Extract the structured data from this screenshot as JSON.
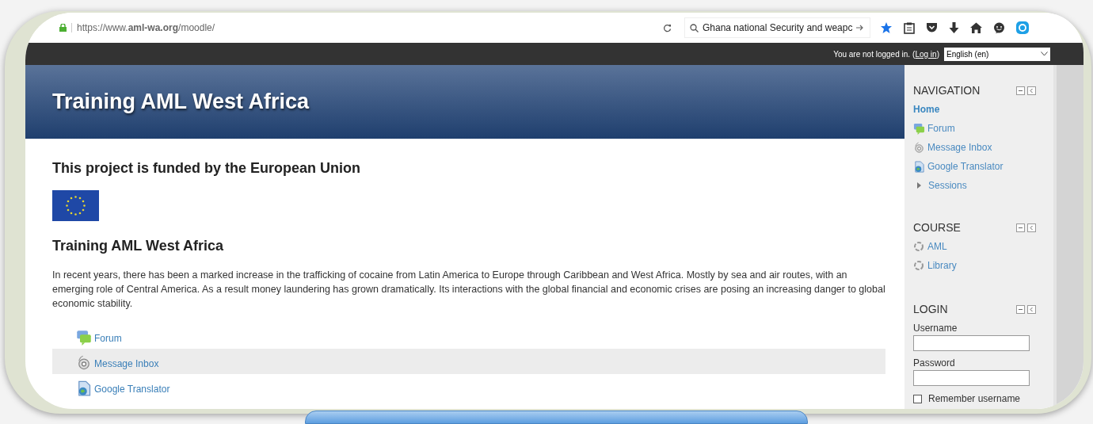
{
  "browser": {
    "url": "https://www.**aml-wa.org**/moodle/",
    "search_value": "Ghana national Security and weapc"
  },
  "top_bar": {
    "status": "You are not logged in.",
    "bracket_open": "(",
    "login_link": "Log in",
    "bracket_close": ")",
    "language": "English (en)"
  },
  "header": {
    "title": "Training AML West Africa"
  },
  "content": {
    "funding_heading": "This project is funded by the European Union",
    "heading": "Training AML West Africa",
    "paragraph": "In recent years, there has been a marked increase in the trafficking of cocaine from Latin America to Europe through Caribbean and West Africa. Mostly by sea and air routes, with an emerging role of Central America. As a result money laundering has grown dramatically. Its interactions with the global financial and economic crises are posing an increasing danger to global economic stability.",
    "links": [
      {
        "label": "Forum",
        "kind": "forum",
        "highlighted": false
      },
      {
        "label": "Message Inbox",
        "kind": "inbox",
        "highlighted": true
      },
      {
        "label": "Google Translator",
        "kind": "page",
        "highlighted": false
      }
    ]
  },
  "sidebar": {
    "navigation": {
      "title": "NAVIGATION",
      "items": [
        {
          "label": "Home",
          "kind": "current"
        },
        {
          "label": "Forum",
          "kind": "forum"
        },
        {
          "label": "Message Inbox",
          "kind": "inbox"
        },
        {
          "label": "Google Translator",
          "kind": "page"
        },
        {
          "label": "Sessions",
          "kind": "branch"
        }
      ]
    },
    "course": {
      "title": "COURSE",
      "items": [
        {
          "label": "AML"
        },
        {
          "label": "Library"
        }
      ]
    },
    "login": {
      "title": "LOGIN",
      "username_label": "Username",
      "password_label": "Password",
      "remember_label": "Remember username",
      "remember_checked": false
    }
  }
}
